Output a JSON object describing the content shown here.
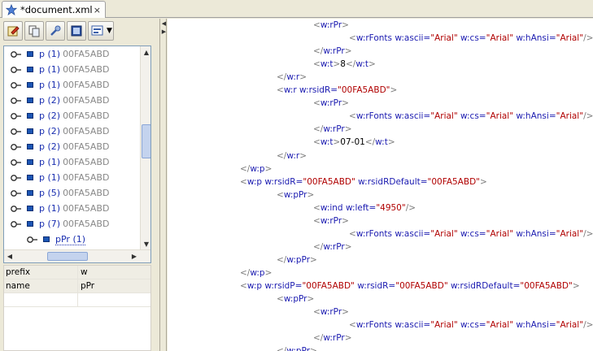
{
  "tab": {
    "title": "*document.xml",
    "close": "×",
    "icon": "star-icon"
  },
  "toolbar": {
    "buttons": [
      "edit-icon",
      "copy-icon",
      "tools-icon",
      "frame-icon",
      "view-icon"
    ],
    "dropdown_arrow": "▼"
  },
  "tree": {
    "rows": [
      {
        "name": "p (1)",
        "meta": "00FA5ABD"
      },
      {
        "name": "p (1)",
        "meta": "00FA5ABD"
      },
      {
        "name": "p (1)",
        "meta": "00FA5ABD"
      },
      {
        "name": "p (2)",
        "meta": "00FA5ABD"
      },
      {
        "name": "p (2)",
        "meta": "00FA5ABD"
      },
      {
        "name": "p (2)",
        "meta": "00FA5ABD"
      },
      {
        "name": "p (2)",
        "meta": "00FA5ABD"
      },
      {
        "name": "p (1)",
        "meta": "00FA5ABD"
      },
      {
        "name": "p (1)",
        "meta": "00FA5ABD"
      },
      {
        "name": "p (5)",
        "meta": "00FA5ABD"
      },
      {
        "name": "p (1)",
        "meta": "00FA5ABD"
      },
      {
        "name": "p (7)",
        "meta": "00FA5ABD"
      }
    ],
    "child": {
      "name": "pPr (1)"
    }
  },
  "properties": [
    {
      "key": "prefix",
      "value": "w"
    },
    {
      "key": "name",
      "value": "pPr"
    },
    {
      "key": "",
      "value": ""
    }
  ],
  "editor": {
    "lines": [
      {
        "indent": 3,
        "tokens": [
          [
            "br",
            "<"
          ],
          [
            "tg",
            "w:rPr"
          ],
          [
            "br",
            ">"
          ]
        ]
      },
      {
        "indent": 4,
        "tokens": [
          [
            "br",
            "<"
          ],
          [
            "tg",
            "w:rFonts "
          ],
          [
            "an",
            "w:ascii="
          ],
          [
            "av",
            "\"Arial\""
          ],
          [
            "an",
            " w:cs="
          ],
          [
            "av",
            "\"Arial\""
          ],
          [
            "an",
            " w:hAnsi="
          ],
          [
            "av",
            "\"Arial\""
          ],
          [
            "br",
            "/>"
          ]
        ]
      },
      {
        "indent": 3,
        "tokens": [
          [
            "br",
            "</"
          ],
          [
            "tg",
            "w:rPr"
          ],
          [
            "br",
            ">"
          ]
        ]
      },
      {
        "indent": 3,
        "tokens": [
          [
            "br",
            "<"
          ],
          [
            "tg",
            "w:t"
          ],
          [
            "br",
            ">"
          ],
          [
            "tx",
            "8"
          ],
          [
            "br",
            "</"
          ],
          [
            "tg",
            "w:t"
          ],
          [
            "br",
            ">"
          ]
        ]
      },
      {
        "indent": 2,
        "tokens": [
          [
            "br",
            "</"
          ],
          [
            "tg",
            "w:r"
          ],
          [
            "br",
            ">"
          ]
        ]
      },
      {
        "indent": 2,
        "tokens": [
          [
            "br",
            "<"
          ],
          [
            "tg",
            "w:r "
          ],
          [
            "an",
            "w:rsidR="
          ],
          [
            "av",
            "\"00FA5ABD\""
          ],
          [
            "br",
            ">"
          ]
        ]
      },
      {
        "indent": 3,
        "tokens": [
          [
            "br",
            "<"
          ],
          [
            "tg",
            "w:rPr"
          ],
          [
            "br",
            ">"
          ]
        ]
      },
      {
        "indent": 4,
        "tokens": [
          [
            "br",
            "<"
          ],
          [
            "tg",
            "w:rFonts "
          ],
          [
            "an",
            "w:ascii="
          ],
          [
            "av",
            "\"Arial\""
          ],
          [
            "an",
            " w:cs="
          ],
          [
            "av",
            "\"Arial\""
          ],
          [
            "an",
            " w:hAnsi="
          ],
          [
            "av",
            "\"Arial\""
          ],
          [
            "br",
            "/>"
          ]
        ]
      },
      {
        "indent": 3,
        "tokens": [
          [
            "br",
            "</"
          ],
          [
            "tg",
            "w:rPr"
          ],
          [
            "br",
            ">"
          ]
        ]
      },
      {
        "indent": 3,
        "tokens": [
          [
            "br",
            "<"
          ],
          [
            "tg",
            "w:t"
          ],
          [
            "br",
            ">"
          ],
          [
            "tx",
            "07-01"
          ],
          [
            "br",
            "</"
          ],
          [
            "tg",
            "w:t"
          ],
          [
            "br",
            ">"
          ]
        ]
      },
      {
        "indent": 2,
        "tokens": [
          [
            "br",
            "</"
          ],
          [
            "tg",
            "w:r"
          ],
          [
            "br",
            ">"
          ]
        ]
      },
      {
        "indent": 1,
        "tokens": [
          [
            "br",
            "</"
          ],
          [
            "tg",
            "w:p"
          ],
          [
            "br",
            ">"
          ]
        ]
      },
      {
        "indent": 1,
        "tokens": [
          [
            "br",
            "<"
          ],
          [
            "tg",
            "w:p "
          ],
          [
            "an",
            "w:rsidR="
          ],
          [
            "av",
            "\"00FA5ABD\""
          ],
          [
            "an",
            " w:rsidRDefault="
          ],
          [
            "av",
            "\"00FA5ABD\""
          ],
          [
            "br",
            ">"
          ]
        ]
      },
      {
        "indent": 2,
        "tokens": [
          [
            "br",
            "<"
          ],
          [
            "tg",
            "w:pPr"
          ],
          [
            "br",
            ">"
          ]
        ]
      },
      {
        "indent": 3,
        "tokens": [
          [
            "br",
            "<"
          ],
          [
            "tg",
            "w:ind "
          ],
          [
            "an",
            "w:left="
          ],
          [
            "av",
            "\"4950\""
          ],
          [
            "br",
            "/>"
          ]
        ]
      },
      {
        "indent": 3,
        "tokens": [
          [
            "br",
            "<"
          ],
          [
            "tg",
            "w:rPr"
          ],
          [
            "br",
            ">"
          ]
        ]
      },
      {
        "indent": 4,
        "tokens": [
          [
            "br",
            "<"
          ],
          [
            "tg",
            "w:rFonts "
          ],
          [
            "an",
            "w:ascii="
          ],
          [
            "av",
            "\"Arial\""
          ],
          [
            "an",
            " w:cs="
          ],
          [
            "av",
            "\"Arial\""
          ],
          [
            "an",
            " w:hAnsi="
          ],
          [
            "av",
            "\"Arial\""
          ],
          [
            "br",
            "/>"
          ]
        ]
      },
      {
        "indent": 3,
        "tokens": [
          [
            "br",
            "</"
          ],
          [
            "tg",
            "w:rPr"
          ],
          [
            "br",
            ">"
          ]
        ]
      },
      {
        "indent": 2,
        "tokens": [
          [
            "br",
            "</"
          ],
          [
            "tg",
            "w:pPr"
          ],
          [
            "br",
            ">"
          ]
        ]
      },
      {
        "indent": 1,
        "tokens": [
          [
            "br",
            "</"
          ],
          [
            "tg",
            "w:p"
          ],
          [
            "br",
            ">"
          ]
        ]
      },
      {
        "indent": 1,
        "tokens": [
          [
            "br",
            "<"
          ],
          [
            "tg",
            "w:p "
          ],
          [
            "an",
            "w:rsidP="
          ],
          [
            "av",
            "\"00FA5ABD\""
          ],
          [
            "an",
            " w:rsidR="
          ],
          [
            "av",
            "\"00FA5ABD\""
          ],
          [
            "an",
            " w:rsidRDefault="
          ],
          [
            "av",
            "\"00FA5ABD\""
          ],
          [
            "br",
            ">"
          ]
        ]
      },
      {
        "indent": 2,
        "tokens": [
          [
            "br",
            "<"
          ],
          [
            "tg",
            "w:pPr"
          ],
          [
            "br",
            ">"
          ]
        ]
      },
      {
        "indent": 3,
        "tokens": [
          [
            "br",
            "<"
          ],
          [
            "tg",
            "w:rPr"
          ],
          [
            "br",
            ">"
          ]
        ]
      },
      {
        "indent": 4,
        "tokens": [
          [
            "br",
            "<"
          ],
          [
            "tg",
            "w:rFonts "
          ],
          [
            "an",
            "w:ascii="
          ],
          [
            "av",
            "\"Arial\""
          ],
          [
            "an",
            " w:cs="
          ],
          [
            "av",
            "\"Arial\""
          ],
          [
            "an",
            " w:hAnsi="
          ],
          [
            "av",
            "\"Arial\""
          ],
          [
            "br",
            "/>"
          ]
        ]
      },
      {
        "indent": 3,
        "tokens": [
          [
            "br",
            "</"
          ],
          [
            "tg",
            "w:rPr"
          ],
          [
            "br",
            ">"
          ]
        ]
      },
      {
        "indent": 2,
        "tokens": [
          [
            "br",
            "</"
          ],
          [
            "tg",
            "w:pPr"
          ],
          [
            "br",
            ">"
          ]
        ]
      }
    ]
  }
}
